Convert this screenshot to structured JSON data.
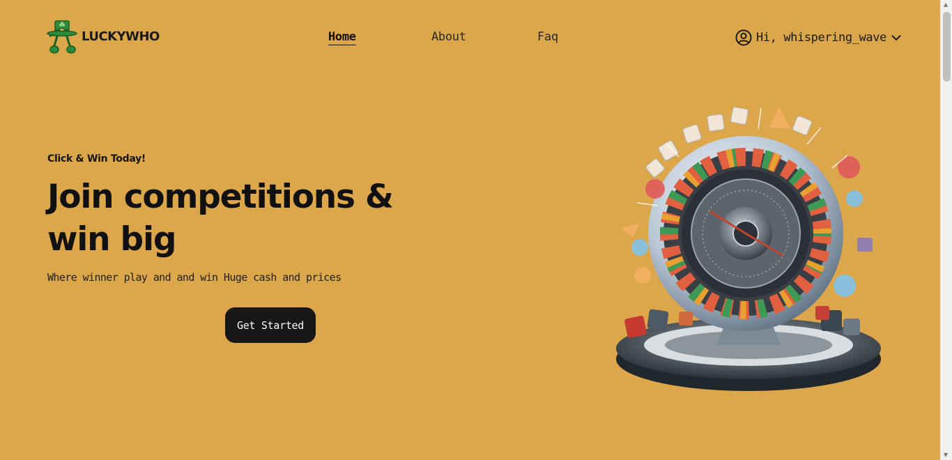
{
  "header": {
    "logo_text": "LUCKYWHO",
    "nav": {
      "home": "Home",
      "about": "About",
      "faq": "Faq"
    },
    "user_greeting": "Hi, whispering_wave"
  },
  "hero": {
    "eyebrow": "Click & Win Today!",
    "headline": "Join competitions & win big",
    "subline": "Where winner play and and win Huge cash and prices",
    "cta_label": "Get Started"
  },
  "colors": {
    "background": "#DCA64A",
    "button": "#171717",
    "logo_green": "#2E8B3A"
  },
  "icons": [
    "leprechaun-hat-logo",
    "user-circle-icon",
    "chevron-down-icon",
    "roulette-wheel-illustration"
  ]
}
